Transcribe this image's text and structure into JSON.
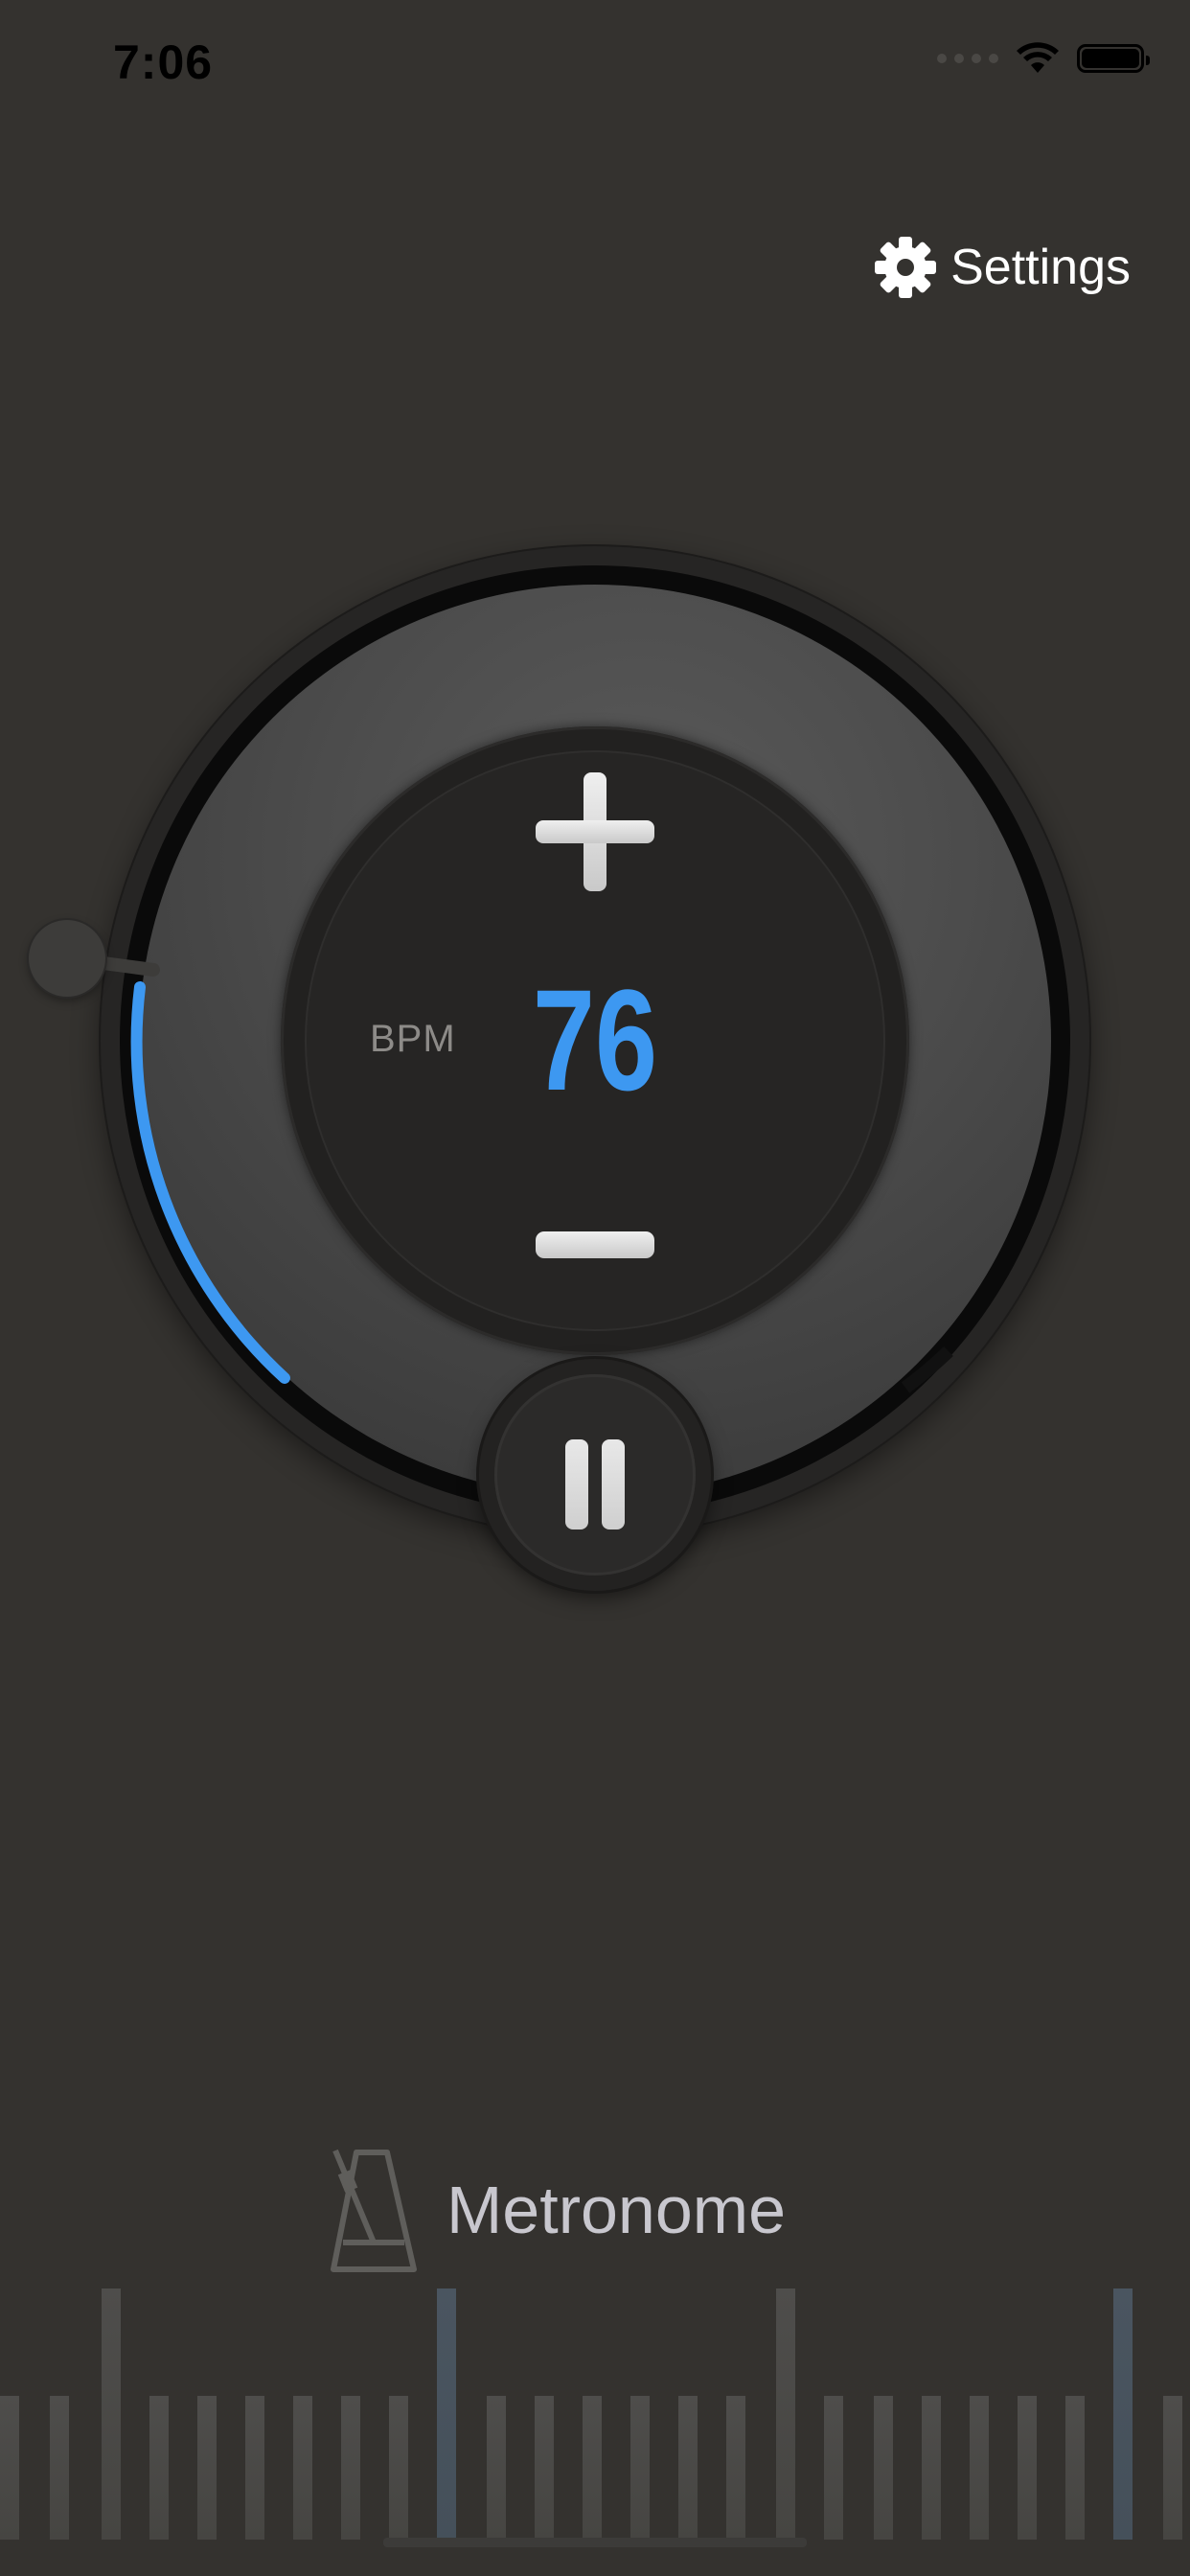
{
  "status_bar": {
    "time": "7:06",
    "icons": [
      "signal-dots-icon",
      "wifi-icon",
      "battery-icon"
    ]
  },
  "header": {
    "settings_label": "Settings",
    "settings_icon": "gear-icon"
  },
  "metronome": {
    "bpm_label": "BPM",
    "bpm_value": "76",
    "plus_icon": "plus-icon",
    "minus_icon": "minus-icon",
    "pause_icon": "pause-icon"
  },
  "brand": {
    "title": "Metronome",
    "icon": "metronome-icon"
  },
  "colors": {
    "background": "#34322f",
    "accent": "#3d98f1",
    "bpm_label": "#8d8b88",
    "brand_text": "#c8c7ce"
  }
}
